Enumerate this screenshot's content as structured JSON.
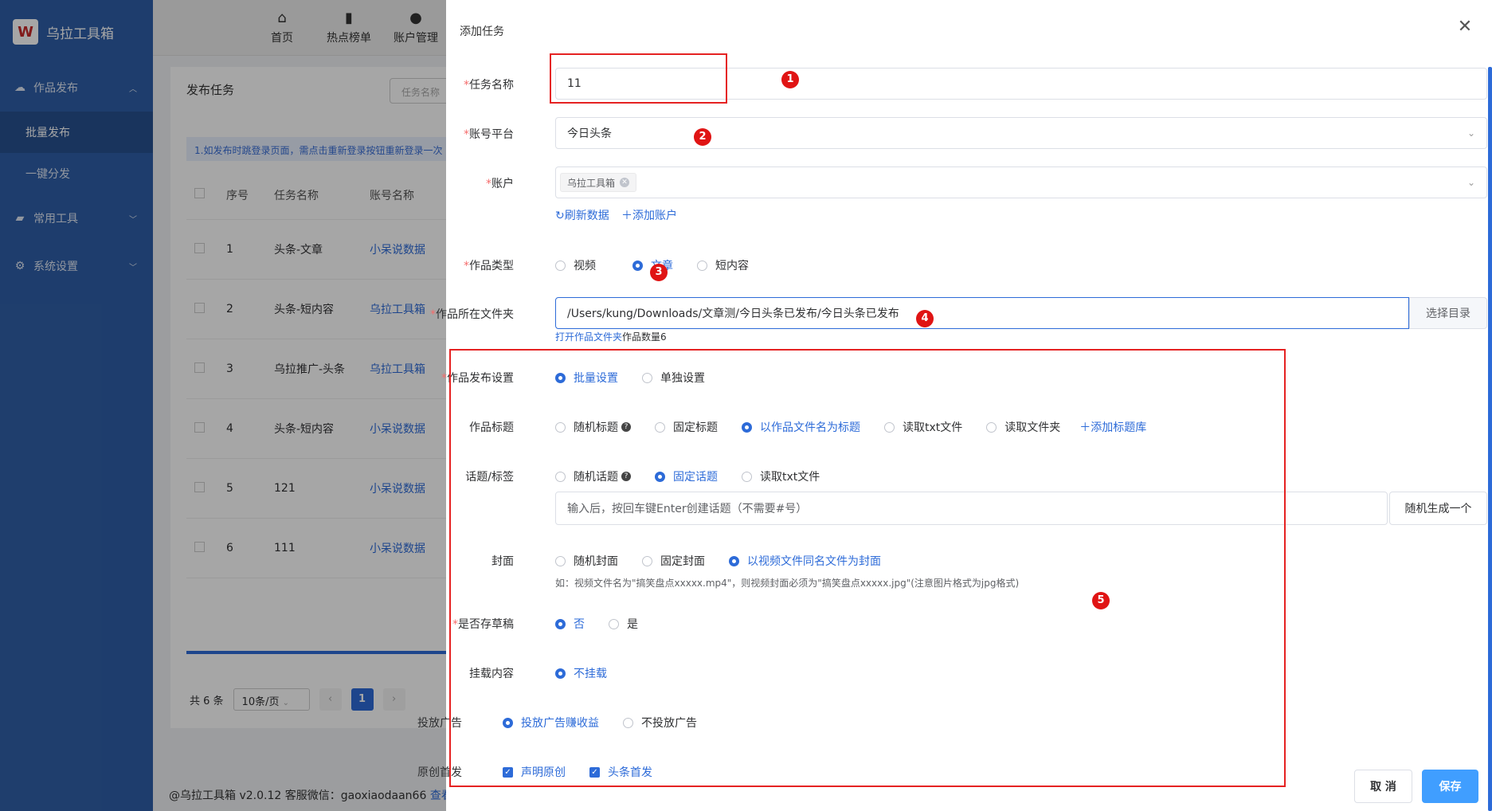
{
  "app": {
    "brand": "乌拉工具箱",
    "sidebar": [
      {
        "type": "group",
        "label": "作品发布",
        "chevron": "up"
      },
      {
        "type": "sub",
        "label": "批量发布",
        "active": true
      },
      {
        "type": "sub",
        "label": "一键分发",
        "active": false
      },
      {
        "type": "group",
        "label": "常用工具",
        "chevron": "down"
      },
      {
        "type": "group",
        "label": "系统设置",
        "chevron": "down"
      }
    ],
    "topnav": [
      {
        "label": "首页",
        "icon": "home-icon"
      },
      {
        "label": "热点榜单",
        "icon": "bar-chart-icon"
      },
      {
        "label": "账户管理",
        "icon": "user-icon"
      }
    ],
    "content": {
      "title": "发布任务",
      "search_placeholder": "任务名称",
      "tip": "1.如发布时跳登录页面，需点击重新登录按钮重新登录一次",
      "headers": [
        "序号",
        "任务名称",
        "账号名称"
      ],
      "rows": [
        {
          "no": "1",
          "name": "头条-文章",
          "account": "小呆说数据"
        },
        {
          "no": "2",
          "name": "头条-短内容",
          "account": "乌拉工具箱"
        },
        {
          "no": "3",
          "name": "乌拉推广-头条",
          "account": "乌拉工具箱"
        },
        {
          "no": "4",
          "name": "头条-短内容",
          "account": "小呆说数据"
        },
        {
          "no": "5",
          "name": "121",
          "account": "小呆说数据"
        },
        {
          "no": "6",
          "name": "111",
          "account": "小呆说数据"
        }
      ],
      "pager": {
        "total": "共 6 条",
        "page_size": "10条/页",
        "current": "1"
      }
    },
    "footer": {
      "text": "@乌拉工具箱 v2.0.12 客服微信：gaoxiaodaan66 ",
      "link": "查看"
    }
  },
  "drawer": {
    "title": "添加任务",
    "task_name": {
      "label": "任务名称",
      "value": "11"
    },
    "platform": {
      "label": "账号平台",
      "value": "今日头条"
    },
    "account": {
      "label": "账户",
      "tag": "乌拉工具箱",
      "refresh": "刷新数据",
      "add": "添加账户"
    },
    "work_type": {
      "label": "作品类型",
      "options": [
        {
          "label": "视频",
          "checked": false
        },
        {
          "label": "文章",
          "checked": true
        },
        {
          "label": "短内容",
          "checked": false
        }
      ]
    },
    "folder": {
      "label": "作品所在文件夹",
      "value": "/Users/kung/Downloads/文章测/今日头条已发布/今日头条已发布",
      "button": "选择目录",
      "open_link": "打开作品文件夹",
      "count_text": "作品数量6"
    },
    "publish_setting": {
      "label": "作品发布设置",
      "options": [
        {
          "label": "批量设置",
          "checked": true
        },
        {
          "label": "单独设置",
          "checked": false
        }
      ]
    },
    "work_title": {
      "label": "作品标题",
      "options": [
        {
          "label": "随机标题",
          "checked": false,
          "help": true
        },
        {
          "label": "固定标题",
          "checked": false
        },
        {
          "label": "以作品文件名为标题",
          "checked": true
        },
        {
          "label": "读取txt文件",
          "checked": false
        },
        {
          "label": "读取文件夹",
          "checked": false
        }
      ],
      "add_link": "添加标题库"
    },
    "topic": {
      "label": "话题/标签",
      "options": [
        {
          "label": "随机话题",
          "checked": false,
          "help": true
        },
        {
          "label": "固定话题",
          "checked": true
        },
        {
          "label": "读取txt文件",
          "checked": false
        }
      ],
      "placeholder": "输入后，按回车键Enter创建话题（不需要#号）",
      "button": "随机生成一个"
    },
    "cover": {
      "label": "封面",
      "options": [
        {
          "label": "随机封面",
          "checked": false
        },
        {
          "label": "固定封面",
          "checked": false
        },
        {
          "label": "以视频文件同名文件为封面",
          "checked": true
        }
      ],
      "hint": "如：视频文件名为\"搞笑盘点xxxxx.mp4\"，则视频封面必须为\"搞笑盘点xxxxx.jpg\"(注意图片格式为jpg格式)"
    },
    "draft": {
      "label": "是否存草稿",
      "options": [
        {
          "label": "否",
          "checked": true
        },
        {
          "label": "是",
          "checked": false
        }
      ]
    },
    "mount": {
      "label": "挂载内容",
      "options": [
        {
          "label": "不挂载",
          "checked": true
        }
      ]
    },
    "ads": {
      "label": "投放广告",
      "options": [
        {
          "label": "投放广告赚收益",
          "checked": true
        },
        {
          "label": "不投放广告",
          "checked": false
        }
      ]
    },
    "original": {
      "label": "原创首发",
      "checks": [
        {
          "label": "声明原创",
          "checked": true
        },
        {
          "label": "头条首发",
          "checked": true
        }
      ]
    },
    "cancel": "取 消",
    "save": "保存"
  },
  "markers": [
    "1",
    "2",
    "3",
    "4",
    "5"
  ],
  "colors": {
    "primary": "#2d6bd8",
    "sidebar": "#2f5fa8",
    "annotation": "#e52222"
  }
}
